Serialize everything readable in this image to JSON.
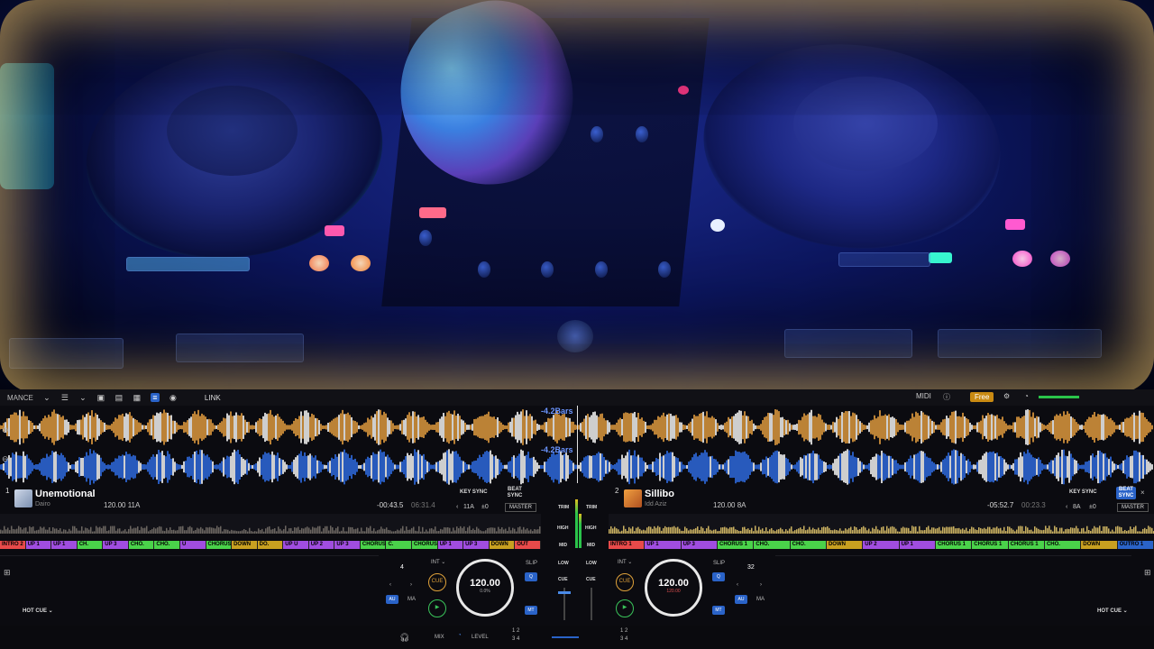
{
  "topbar": {
    "mode": "MANCE",
    "link": "LINK",
    "midi": "MIDI",
    "free": "Free"
  },
  "waveform": {
    "top_bars": "-4.2Bars",
    "bottom_bars": "-4.2Bars"
  },
  "deckA": {
    "number": "1",
    "title": "Unemotional",
    "artist": "Dairo",
    "bpm_key": "120.00 11A",
    "time_remaining": "-00:43.5",
    "time_elapsed": "06:31.4",
    "key_sync": "KEY SYNC",
    "beat_sync": "BEAT SYNC",
    "key": "11A",
    "key_shift": "±0",
    "master": "MASTER",
    "beatjump": "4",
    "cue_label": "CUE",
    "jog_bpm": "120.00",
    "jog_pct": "0.0%",
    "slip": "SLIP",
    "q": "Q",
    "au": "AU",
    "ma": "MA",
    "mt": "MT",
    "int": "INT",
    "hot_cue": "HOT CUE",
    "cues": [
      {
        "label": "INTRO 2",
        "color": "#e84a4a"
      },
      {
        "label": "UP 1",
        "color": "#a04de0"
      },
      {
        "label": "UP 1",
        "color": "#a04de0"
      },
      {
        "label": "CH.",
        "color": "#4ad24a"
      },
      {
        "label": "UP 3",
        "color": "#a04de0"
      },
      {
        "label": "CHO.",
        "color": "#4ad24a"
      },
      {
        "label": "CHO.",
        "color": "#4ad24a"
      },
      {
        "label": "U",
        "color": "#a04de0"
      },
      {
        "label": "CHORUS 1",
        "color": "#4ad24a"
      },
      {
        "label": "DOWN",
        "color": "#c8a020"
      },
      {
        "label": "DO.",
        "color": "#c8a020"
      },
      {
        "label": "UP U",
        "color": "#a04de0"
      },
      {
        "label": "UP 2",
        "color": "#a04de0"
      },
      {
        "label": "UP 3",
        "color": "#a04de0"
      },
      {
        "label": "CHORUS",
        "color": "#4ad24a"
      },
      {
        "label": "C.",
        "color": "#4ad24a"
      },
      {
        "label": "CHORUS 1",
        "color": "#4ad24a"
      },
      {
        "label": "UP 1",
        "color": "#a04de0"
      },
      {
        "label": "UP 3",
        "color": "#a04de0"
      },
      {
        "label": "DOWN",
        "color": "#c8a020"
      },
      {
        "label": "OUT",
        "color": "#e84a4a"
      }
    ]
  },
  "deckB": {
    "number": "2",
    "title": "Sillibo",
    "artist": "Idd Aziz",
    "bpm_key": "120.00 8A",
    "time_remaining": "-05:52.7",
    "time_elapsed": "00:23.3",
    "key_sync": "KEY SYNC",
    "beat_sync": "BEAT SYNC",
    "key": "8A",
    "key_shift": "±0",
    "master": "MASTER",
    "beatjump": "32",
    "cue_label": "CUE",
    "jog_bpm": "120.00",
    "jog_pct": "120.00",
    "slip": "SLIP",
    "q": "Q",
    "au": "AU",
    "ma": "MA",
    "mt": "MT",
    "int": "INT",
    "hot_cue": "HOT CUE",
    "cues": [
      {
        "label": "INTRO 1",
        "color": "#e84a4a"
      },
      {
        "label": "UP 1",
        "color": "#a04de0"
      },
      {
        "label": "UP 3",
        "color": "#a04de0"
      },
      {
        "label": "CHORUS 1",
        "color": "#4ad24a"
      },
      {
        "label": "CHO.",
        "color": "#4ad24a"
      },
      {
        "label": "CHO.",
        "color": "#4ad24a"
      },
      {
        "label": "DOWN",
        "color": "#c8a020"
      },
      {
        "label": "UP 2",
        "color": "#a04de0"
      },
      {
        "label": "UP 1",
        "color": "#a04de0"
      },
      {
        "label": "CHORUS 1",
        "color": "#4ad24a"
      },
      {
        "label": "CHORUS 1",
        "color": "#4ad24a"
      },
      {
        "label": "CHORUS 1",
        "color": "#4ad24a"
      },
      {
        "label": "CHO.",
        "color": "#4ad24a"
      },
      {
        "label": "DOWN",
        "color": "#c8a020"
      },
      {
        "label": "OUTRO 1",
        "color": "#2a63c8"
      }
    ]
  },
  "mixer": {
    "trim": "TRIM",
    "high": "HIGH",
    "mid": "MID",
    "low": "LOW",
    "cue": "CUE"
  },
  "bottom": {
    "mix": "MIX",
    "level": "LEVEL",
    "ch_a": "1 2",
    "ch_a2": "3 4",
    "ch_b": "1 2",
    "ch_b2": "3 4"
  },
  "colors": {
    "accent_blue": "#2a63c8",
    "cue_orange": "#e0a23a",
    "play_green": "#3ac45a",
    "wave_blue": "#2f6fe8",
    "wave_orange": "#e8a040"
  }
}
